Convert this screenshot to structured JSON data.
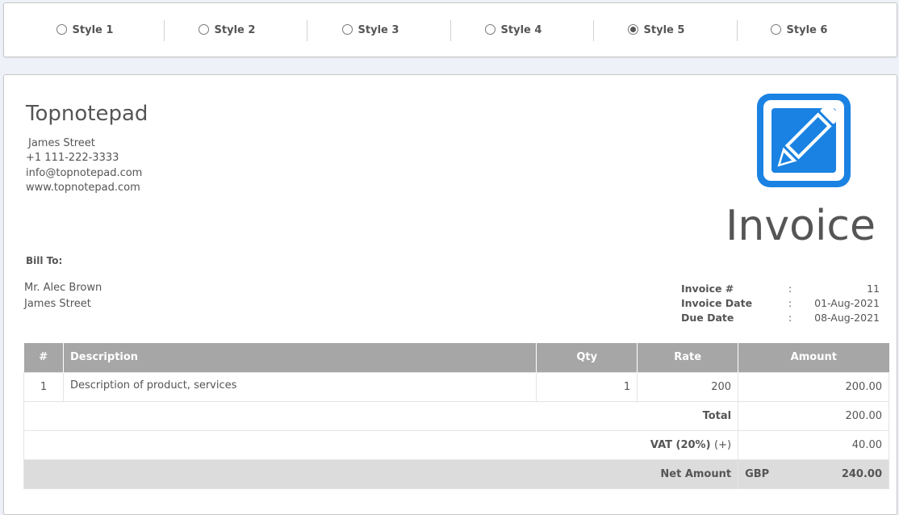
{
  "style_selector": {
    "options": [
      {
        "label": "Style 1",
        "checked": false
      },
      {
        "label": "Style 2",
        "checked": false
      },
      {
        "label": "Style 3",
        "checked": false
      },
      {
        "label": "Style 4",
        "checked": false
      },
      {
        "label": "Style 5",
        "checked": true
      },
      {
        "label": "Style 6",
        "checked": false
      }
    ]
  },
  "company": {
    "name": "Topnotepad",
    "address": "James Street",
    "phone": "+1 111-222-3333",
    "email": "info@topnotepad.com",
    "website": "www.topnotepad.com",
    "logo_icon": "pencil-square-icon",
    "logo_color": "#1a82e2"
  },
  "invoice_title": "Invoice",
  "bill_to": {
    "label": "Bill To:",
    "name": "Mr. Alec Brown",
    "address": "James Street"
  },
  "meta": {
    "number_label": "Invoice #",
    "number_value": "11",
    "date_label": "Invoice Date",
    "date_value": "01-Aug-2021",
    "due_label": "Due Date",
    "due_value": "08-Aug-2021",
    "colon": ":"
  },
  "table": {
    "headers": {
      "num": "#",
      "description": "Description",
      "qty": "Qty",
      "rate": "Rate",
      "amount": "Amount"
    },
    "rows": [
      {
        "num": "1",
        "description": "Description of product, services",
        "qty": "1",
        "rate": "200",
        "amount": "200.00"
      }
    ],
    "total_label": "Total",
    "total_value": "200.00",
    "vat_label": "VAT (20%)",
    "vat_sign": "(+)",
    "vat_value": "40.00",
    "net_label": "Net Amount",
    "currency": "GBP",
    "net_value": "240.00"
  }
}
